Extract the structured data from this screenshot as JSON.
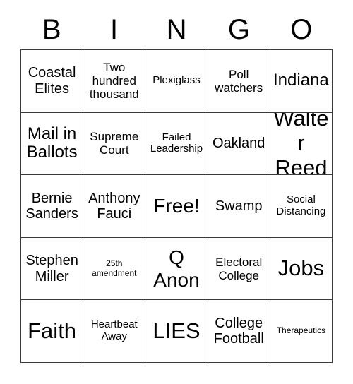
{
  "header": {
    "letters": [
      "B",
      "I",
      "N",
      "G",
      "O"
    ]
  },
  "colors": {
    "background": "#ffffff",
    "grid_line": "#3a3a3a",
    "text": "#000000"
  },
  "card": {
    "columns": 5,
    "rows": 5,
    "free_space_label": "Free!",
    "cells": [
      {
        "text": "Coastal Elites",
        "size": "fs-m"
      },
      {
        "text": "Two hundred thousand",
        "size": "fs-s"
      },
      {
        "text": "Plexiglass",
        "size": "fs-xs"
      },
      {
        "text": "Poll watchers",
        "size": "fs-s"
      },
      {
        "text": "Indiana",
        "size": "fs-l"
      },
      {
        "text": "Mail in Ballots",
        "size": "fs-l"
      },
      {
        "text": "Supreme Court",
        "size": "fs-s"
      },
      {
        "text": "Failed Leadership",
        "size": "fs-xs"
      },
      {
        "text": "Oakland",
        "size": "fs-m"
      },
      {
        "text": "Walter Reed",
        "size": "fs-xxl"
      },
      {
        "text": "Bernie Sanders",
        "size": "fs-m"
      },
      {
        "text": "Anthony Fauci",
        "size": "fs-m"
      },
      {
        "text": "Free!",
        "size": "fs-xl"
      },
      {
        "text": "Swamp",
        "size": "fs-m"
      },
      {
        "text": "Social Distancing",
        "size": "fs-xs"
      },
      {
        "text": "Stephen Miller",
        "size": "fs-m"
      },
      {
        "text": "25th amendment",
        "size": "fs-xxs"
      },
      {
        "text": "Q Anon",
        "size": "fs-xl"
      },
      {
        "text": "Electoral College",
        "size": "fs-s"
      },
      {
        "text": "Jobs",
        "size": "fs-xxl"
      },
      {
        "text": "Faith",
        "size": "fs-xxl"
      },
      {
        "text": "Heartbeat Away",
        "size": "fs-xs"
      },
      {
        "text": "LIES",
        "size": "fs-xxl"
      },
      {
        "text": "College Football",
        "size": "fs-m"
      },
      {
        "text": "Therapeutics",
        "size": "fs-xxs"
      }
    ]
  }
}
